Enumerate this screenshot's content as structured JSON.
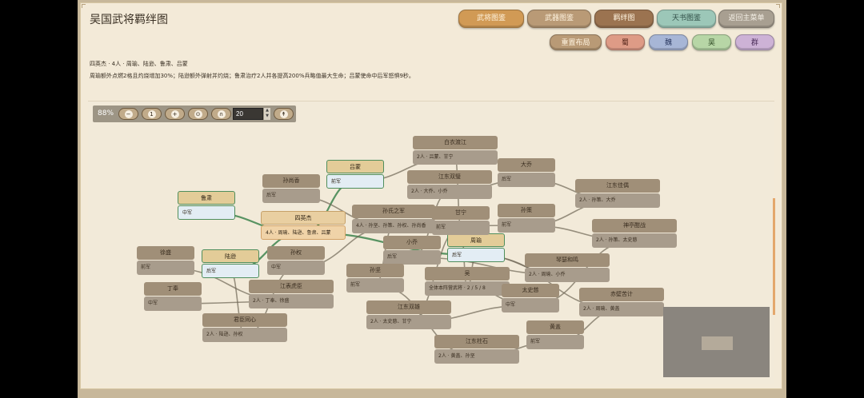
{
  "header": {
    "title": "吴国武将羁绊图"
  },
  "nav_buttons": [
    "武将图鉴",
    "武器图鉴",
    "羁绊图",
    "天书图鉴",
    "返回主菜单"
  ],
  "action_buttons": [
    "重置布局",
    "蜀",
    "魏",
    "吴",
    "群"
  ],
  "info": {
    "line1": "四英杰 · 4人 · 周瑜、陆逊、鲁肃、吕蒙",
    "line2": "周瑜额外点燃2格且灼烧增加30%；陆逊额外弹射并灼烧；鲁肃治疗2人并各提高200%兵略值最大生命；吕蒙使命中后军怒惧9秒。"
  },
  "toolbar": {
    "zoom": "88%",
    "step_value": "20",
    "minus": "−",
    "one": "1",
    "plus": "+"
  },
  "nodes": [
    {
      "name": "node-lumeng",
      "title": "吕蒙",
      "body": "前军",
      "style": "hl"
    },
    {
      "name": "node-lusu",
      "title": "鲁肃",
      "body": "中军",
      "style": "hl"
    },
    {
      "name": "node-luxun",
      "title": "陆逊",
      "body": "后军",
      "style": "hl"
    },
    {
      "name": "node-zhouyu",
      "title": "周瑜",
      "body": "后军",
      "style": "hl"
    },
    {
      "name": "node-siyingjie",
      "title": "四英杰",
      "body": "4人 · 周瑜、陆逊、鲁肃、吕蒙",
      "style": "core"
    },
    {
      "name": "node-baiyidujiang",
      "title": "白衣渡江",
      "body": "2人 · 吕蒙、甘宁",
      "style": "dim"
    },
    {
      "name": "node-jiangdongshuangbi",
      "title": "江东双璧",
      "body": "2人 · 大乔、小乔",
      "style": "dim"
    },
    {
      "name": "node-daqiao",
      "title": "大乔",
      "body": "后军",
      "style": "dim"
    },
    {
      "name": "node-jiangdongjiaoou",
      "title": "江东佳偶",
      "body": "2人 · 孙策、大乔",
      "style": "dim"
    },
    {
      "name": "node-sunshangxiang",
      "title": "孙尚香",
      "body": "后军",
      "style": "dim"
    },
    {
      "name": "node-sunshizhijun",
      "title": "孙氏之军",
      "body": "4人 · 孙坚、孙策、孙权、孙尚香",
      "style": "dim"
    },
    {
      "name": "node-ganning",
      "title": "甘宁",
      "body": "前军",
      "style": "dim"
    },
    {
      "name": "node-sunce",
      "title": "孙策",
      "body": "前军",
      "style": "dim"
    },
    {
      "name": "node-shenting",
      "title": "神亭酣战",
      "body": "2人 · 孙策、太史慈",
      "style": "dim"
    },
    {
      "name": "node-xiaoqiao",
      "title": "小乔",
      "body": "后军",
      "style": "dim"
    },
    {
      "name": "node-qinse",
      "title": "琴瑟和鸣",
      "body": "2人 · 周瑜、小乔",
      "style": "dim"
    },
    {
      "name": "node-xusheng",
      "title": "徐盛",
      "body": "前军",
      "style": "dim"
    },
    {
      "name": "node-sunquan",
      "title": "孙权",
      "body": "中军",
      "style": "dim"
    },
    {
      "name": "node-dingfeng",
      "title": "丁奉",
      "body": "中军",
      "style": "dim"
    },
    {
      "name": "node-jiangyouhuchen",
      "title": "江表虎臣",
      "body": "2人 · 丁奉、徐盛",
      "style": "dim"
    },
    {
      "name": "node-sunjian",
      "title": "孙坚",
      "body": "前军",
      "style": "dim"
    },
    {
      "name": "node-wu",
      "title": "吴",
      "body": "全体本阵营武将 · 2 / 5 / 8",
      "style": "dim"
    },
    {
      "name": "node-taishici",
      "title": "太史慈",
      "body": "中军",
      "style": "dim"
    },
    {
      "name": "node-chibi",
      "title": "赤壁苦计",
      "body": "2人 · 周瑜、黄盖",
      "style": "dim"
    },
    {
      "name": "node-junchentongxin",
      "title": "君臣同心",
      "body": "2人 · 陆逊、孙权",
      "style": "dim"
    },
    {
      "name": "node-jiangdongshuanghu",
      "title": "江东双雄",
      "body": "2人 · 太史慈、甘宁",
      "style": "dim"
    },
    {
      "name": "node-huanggai",
      "title": "黄盖",
      "body": "前军",
      "style": "dim"
    },
    {
      "name": "node-jiangdongzhushi",
      "title": "江东柱石",
      "body": "2人 · 黄盖、孙坚",
      "style": "dim"
    }
  ],
  "colors": {
    "highlight_edge": "#4f8e5c",
    "dim_edge": "#6f6656",
    "accent": "#e4a76c"
  }
}
